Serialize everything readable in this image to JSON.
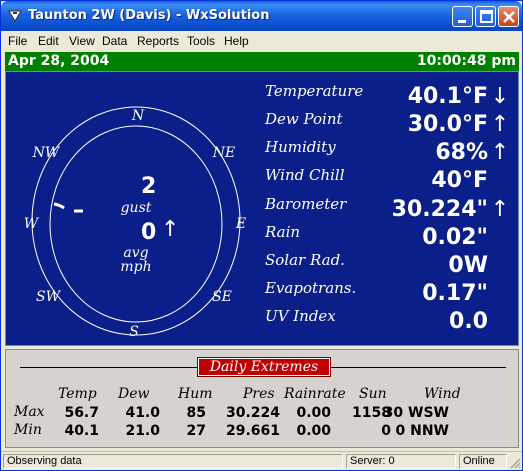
{
  "window": {
    "title": "Taunton 2W (Davis) - WxSolution"
  },
  "menu": [
    "File",
    "Edit",
    "View",
    "Data",
    "Reports",
    "Tools",
    "Help"
  ],
  "datebar": {
    "date": "Apr 28, 2004",
    "time": "10:00:48 pm"
  },
  "compass": {
    "directions": {
      "n": "N",
      "ne": "NE",
      "e": "E",
      "se": "SE",
      "s": "S",
      "sw": "SW",
      "w": "W",
      "nw": "NW"
    },
    "gust_value": "2",
    "gust_label": "gust",
    "avg_value": "0",
    "avg_trend": "↑",
    "avg_label_1": "avg",
    "avg_label_2": "mph"
  },
  "readings": [
    {
      "label": "Temperature",
      "value": "40.1°F",
      "trend": "↓"
    },
    {
      "label": "Dew Point",
      "value": "30.0°F",
      "trend": "↑"
    },
    {
      "label": "Humidity",
      "value": "68%",
      "trend": "↑"
    },
    {
      "label": "Wind Chill",
      "value": "40°F",
      "trend": ""
    },
    {
      "label": "Barometer",
      "value": "30.224\"",
      "trend": "↑"
    },
    {
      "label": "Rain",
      "value": "0.02\"",
      "trend": ""
    },
    {
      "label": "Solar Rad.",
      "value": "0W",
      "trend": ""
    },
    {
      "label": "Evapotrans.",
      "value": "0.17\"",
      "trend": ""
    },
    {
      "label": "UV Index",
      "value": "0.0",
      "trend": ""
    }
  ],
  "extremes": {
    "title": "Daily Extremes",
    "headers": [
      "Temp",
      "Dew",
      "Hum",
      "Pres",
      "Rainrate",
      "Sun",
      "Wind"
    ],
    "rows": [
      {
        "label": "Max",
        "values": [
          "56.7",
          "41.0",
          "85",
          "30.224",
          "0.00",
          "1158",
          "30 WSW"
        ]
      },
      {
        "label": "Min",
        "values": [
          "40.1",
          "21.0",
          "27",
          "29.661",
          "0.00",
          "0",
          "0 NNW"
        ]
      }
    ]
  },
  "status": {
    "left": "Observing data",
    "server": "Server: 0",
    "online": "Online"
  },
  "colors": {
    "panel": "#0a1f8a",
    "datebar": "#008000",
    "extremes_title": "#c00000"
  }
}
